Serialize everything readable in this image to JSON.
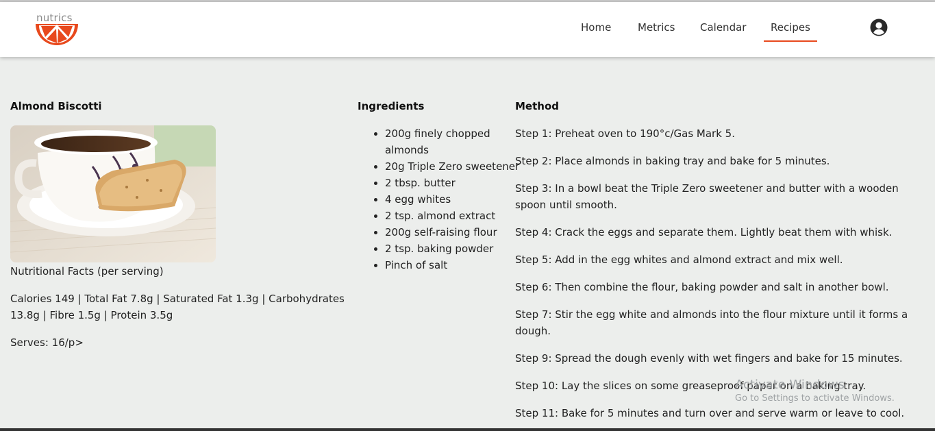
{
  "brand": {
    "logo_text": "nutrics",
    "accent_color": "#e8491d"
  },
  "nav": {
    "items": [
      "Home",
      "Metrics",
      "Calendar",
      "Recipes"
    ],
    "active": "Recipes",
    "user_icon": "user-circle-icon"
  },
  "recipe": {
    "title": "Almond Biscotti",
    "nutrition_title": "Nutritional Facts (per serving)",
    "nutrition_values": "Calories 149 | Total Fat 7.8g | Saturated Fat 1.3g | Carbohydrates 13.8g | Fibre 1.5g | Protein 3.5g",
    "serves": "Serves: 16/p>"
  },
  "ingredients": {
    "heading": "Ingredients",
    "items": [
      "200g finely chopped almonds",
      "20g Triple Zero sweetener",
      "2 tbsp. butter",
      "4 egg whites",
      "2 tsp. almond extract",
      "200g self-raising flour",
      "2 tsp. baking powder",
      "Pinch of salt"
    ]
  },
  "method": {
    "heading": "Method",
    "steps": [
      "Step 1: Preheat oven to 190°c/Gas Mark 5.",
      "Step 2: Place almonds in baking tray and bake for 5 minutes.",
      "Step 3: In a bowl beat the Triple Zero sweetener and butter with a wooden spoon until smooth.",
      "Step 4: Crack the eggs and separate them. Lightly beat them with whisk.",
      "Step 5: Add in the egg whites and almond extract and mix well.",
      "Step 6: Then combine the flour, baking powder and salt in another bowl.",
      "Step 7: Stir the egg white and almonds into the flour mixture until it forms a dough.",
      "Step 9: Spread the dough evenly with wet fingers and bake for 15 minutes.",
      "Step 10: Lay the slices on some greaseproof paper on a baking tray.",
      "Step 11: Bake for 5 minutes and turn over and serve warm or leave to cool."
    ]
  },
  "watermark": {
    "title": "Activate Windows",
    "subtitle": "Go to Settings to activate Windows."
  }
}
